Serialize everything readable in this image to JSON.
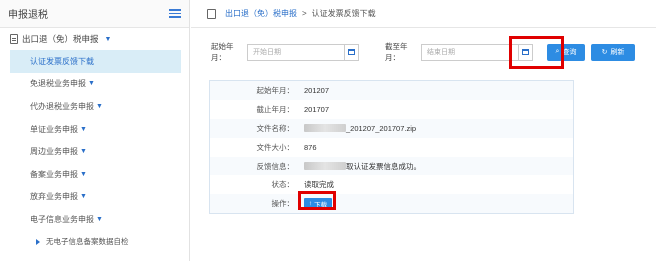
{
  "sidebar": {
    "title": "申报退税",
    "section": "出口退（免）税申报",
    "items": [
      {
        "label": "认证发票反馈下载"
      },
      {
        "label": "免退税业务申报"
      },
      {
        "label": "代办退税业务申报"
      },
      {
        "label": "单证业务申报"
      },
      {
        "label": "周边业务申报"
      },
      {
        "label": "备案业务申报"
      },
      {
        "label": "放弃业务申报"
      },
      {
        "label": "电子信息业务申报"
      }
    ],
    "sub_item": "无电子信息备案数据自检"
  },
  "breadcrumb": {
    "parent": "出口退（免）税申报",
    "separator": ">",
    "current": "认证发票反馈下载"
  },
  "filter": {
    "start_label": "起始年月：",
    "start_placeholder": "开始日期",
    "end_label": "截至年月：",
    "end_placeholder": "结束日期",
    "query_label": "查询",
    "refresh_label": "刷新"
  },
  "detail": {
    "rows": [
      {
        "label": "起始年月：",
        "value": "201207"
      },
      {
        "label": "截止年月：",
        "value": "201707"
      },
      {
        "label": "文件名称：",
        "value": "_201207_201707.zip"
      },
      {
        "label": "文件大小：",
        "value": "876"
      },
      {
        "label": "反馈信息：",
        "value": "取认证发票信息成功。"
      },
      {
        "label": "状态：",
        "value": "读取完成"
      }
    ],
    "action_label": "操作：",
    "download_label": "下载"
  },
  "colors": {
    "accent": "#2d8ce3",
    "highlight": "#e00000"
  }
}
